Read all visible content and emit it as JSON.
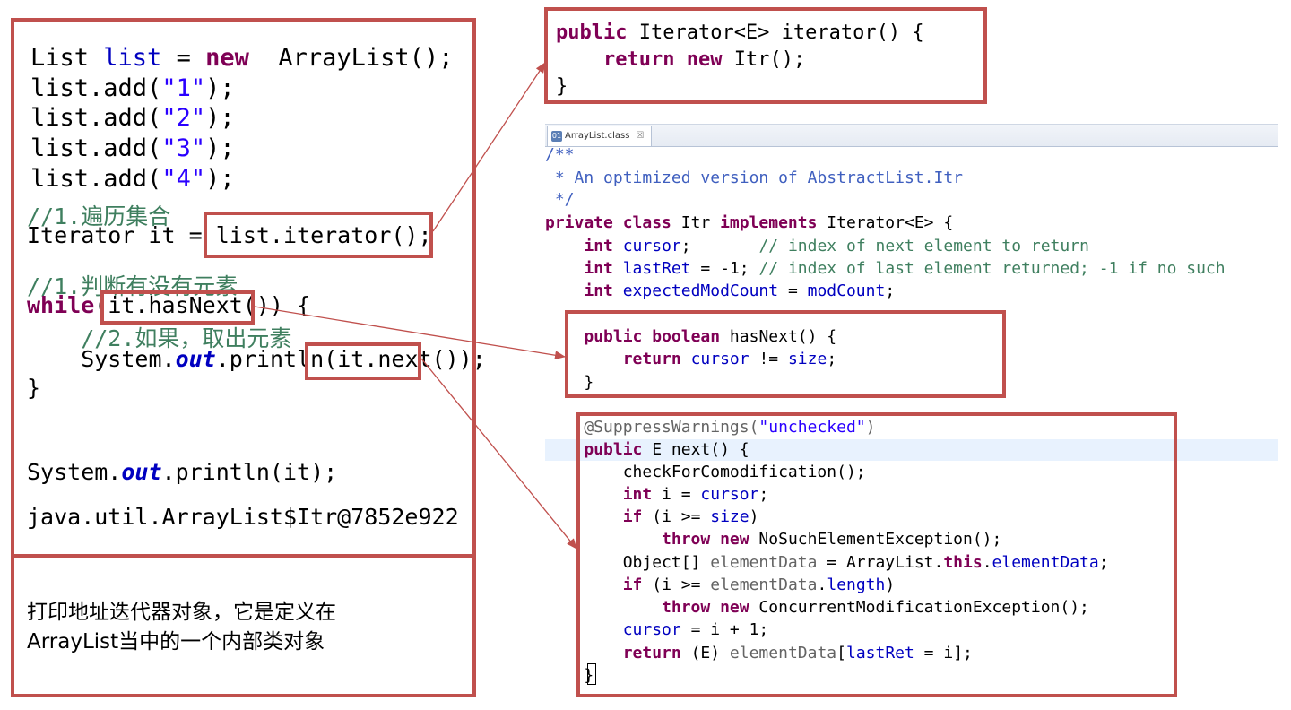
{
  "left_code": [
    [
      [
        "txt",
        "List "
      ],
      [
        "fld",
        "list"
      ],
      [
        "txt",
        " = "
      ],
      [
        "kw",
        "new"
      ],
      [
        "txt",
        "  ArrayList();"
      ]
    ],
    [
      [
        "txt",
        "list.add("
      ],
      [
        "str",
        "\"1\""
      ],
      [
        "txt",
        ");"
      ]
    ],
    [
      [
        "txt",
        "list.add("
      ],
      [
        "str",
        "\"2\""
      ],
      [
        "txt",
        ");"
      ]
    ],
    [
      [
        "txt",
        "list.add("
      ],
      [
        "str",
        "\"3\""
      ],
      [
        "txt",
        ");"
      ]
    ],
    [
      [
        "txt",
        "list.add("
      ],
      [
        "str",
        "\"4\""
      ],
      [
        "txt",
        ");"
      ]
    ],
    [
      [
        "cm",
        "//1.遍历集合"
      ]
    ],
    [
      [
        "txt",
        "Iterator it = list.iterator();"
      ]
    ],
    [
      [
        "cm",
        "//1.判断有没有元素"
      ]
    ],
    [
      [
        "kw",
        "while"
      ],
      [
        "txt",
        "(it.hasNext()) {"
      ]
    ],
    [
      [
        "cm",
        "    //2.如果，取出元素"
      ]
    ],
    [
      [
        "txt",
        "    System."
      ],
      [
        "st",
        "out"
      ],
      [
        "txt",
        ".println(it.next());"
      ]
    ],
    [
      [
        "txt",
        "}"
      ]
    ],
    [
      [
        "txt",
        "System."
      ],
      [
        "st",
        "out"
      ],
      [
        "txt",
        ".println(it);"
      ]
    ],
    [
      [
        "txt",
        "java.util.ArrayList$Itr@7852e922"
      ]
    ]
  ],
  "note_text": "打印地址迭代器对象，它是定义在\nArrayList当中的一个内部类对象",
  "top_right_code": [
    [
      [
        "kw",
        "public"
      ],
      [
        "txt",
        " Iterator<E> iterator() {"
      ]
    ],
    [
      [
        "txt",
        "    "
      ],
      [
        "kw",
        "return"
      ],
      [
        "txt",
        " "
      ],
      [
        "kw",
        "new"
      ],
      [
        "txt",
        " Itr();"
      ]
    ],
    [
      [
        "txt",
        "}"
      ]
    ]
  ],
  "tab": {
    "label": "ArrayList.class",
    "icon": "class-file-icon",
    "close": "☒"
  },
  "source_code": [
    [
      [
        "doc",
        "/**"
      ]
    ],
    [
      [
        "doc",
        " * An optimized version of AbstractList.Itr"
      ]
    ],
    [
      [
        "doc",
        " */"
      ]
    ],
    [
      [
        "kw",
        "private"
      ],
      [
        "txt",
        " "
      ],
      [
        "kw",
        "class"
      ],
      [
        "txt",
        " Itr "
      ],
      [
        "kw",
        "implements"
      ],
      [
        "txt",
        " Iterator<E> {"
      ]
    ],
    [
      [
        "txt",
        "    "
      ],
      [
        "kw",
        "int"
      ],
      [
        "txt",
        " "
      ],
      [
        "fld",
        "cursor"
      ],
      [
        "txt",
        ";       "
      ],
      [
        "cm",
        "// index of next element to return"
      ]
    ],
    [
      [
        "txt",
        "    "
      ],
      [
        "kw",
        "int"
      ],
      [
        "txt",
        " "
      ],
      [
        "fld",
        "lastRet"
      ],
      [
        "txt",
        " = -1; "
      ],
      [
        "cm",
        "// index of last element returned; -1 if no such"
      ]
    ],
    [
      [
        "txt",
        "    "
      ],
      [
        "kw",
        "int"
      ],
      [
        "txt",
        " "
      ],
      [
        "fld",
        "expectedModCount"
      ],
      [
        "txt",
        " = "
      ],
      [
        "fld",
        "modCount"
      ],
      [
        "txt",
        ";"
      ]
    ],
    [
      [
        "txt",
        "    "
      ],
      [
        "kw",
        "public"
      ],
      [
        "txt",
        " "
      ],
      [
        "kw",
        "boolean"
      ],
      [
        "txt",
        " hasNext() {"
      ]
    ],
    [
      [
        "txt",
        "        "
      ],
      [
        "kw",
        "return"
      ],
      [
        "txt",
        " "
      ],
      [
        "fld",
        "cursor"
      ],
      [
        "txt",
        " != "
      ],
      [
        "fld",
        "size"
      ],
      [
        "txt",
        ";"
      ]
    ],
    [
      [
        "txt",
        "    }"
      ]
    ],
    [
      [
        "an",
        "    @SuppressWarnings("
      ],
      [
        "str",
        "\"unchecked\""
      ],
      [
        "an",
        ")"
      ]
    ],
    [
      [
        "txt",
        "    "
      ],
      [
        "kw",
        "public"
      ],
      [
        "txt",
        " E next() {"
      ]
    ],
    [
      [
        "txt",
        "        checkForComodification();"
      ]
    ],
    [
      [
        "txt",
        "        "
      ],
      [
        "kw",
        "int"
      ],
      [
        "txt",
        " i = "
      ],
      [
        "fld",
        "cursor"
      ],
      [
        "txt",
        ";"
      ]
    ],
    [
      [
        "txt",
        "        "
      ],
      [
        "kw",
        "if"
      ],
      [
        "txt",
        " (i >= "
      ],
      [
        "fld",
        "size"
      ],
      [
        "txt",
        ")"
      ]
    ],
    [
      [
        "txt",
        "            "
      ],
      [
        "kw",
        "throw"
      ],
      [
        "txt",
        " "
      ],
      [
        "kw",
        "new"
      ],
      [
        "txt",
        " NoSuchElementException();"
      ]
    ],
    [
      [
        "txt",
        "        Object[] "
      ],
      [
        "an",
        "elementData"
      ],
      [
        "txt",
        " = ArrayList."
      ],
      [
        "kw",
        "this"
      ],
      [
        "txt",
        "."
      ],
      [
        "fld",
        "elementData"
      ],
      [
        "txt",
        ";"
      ]
    ],
    [
      [
        "txt",
        "        "
      ],
      [
        "kw",
        "if"
      ],
      [
        "txt",
        " (i >= "
      ],
      [
        "an",
        "elementData"
      ],
      [
        "txt",
        "."
      ],
      [
        "fld",
        "length"
      ],
      [
        "txt",
        ")"
      ]
    ],
    [
      [
        "txt",
        "            "
      ],
      [
        "kw",
        "throw"
      ],
      [
        "txt",
        " "
      ],
      [
        "kw",
        "new"
      ],
      [
        "txt",
        " ConcurrentModificationException();"
      ]
    ],
    [
      [
        "txt",
        "        "
      ],
      [
        "fld",
        "cursor"
      ],
      [
        "txt",
        " = i + 1;"
      ]
    ],
    [
      [
        "txt",
        "        "
      ],
      [
        "kw",
        "return"
      ],
      [
        "txt",
        " (E) "
      ],
      [
        "an",
        "elementData"
      ],
      [
        "txt",
        "["
      ],
      [
        "fld",
        "lastRet"
      ],
      [
        "txt",
        " = i];"
      ]
    ],
    [
      [
        "txt",
        "    }"
      ]
    ]
  ]
}
